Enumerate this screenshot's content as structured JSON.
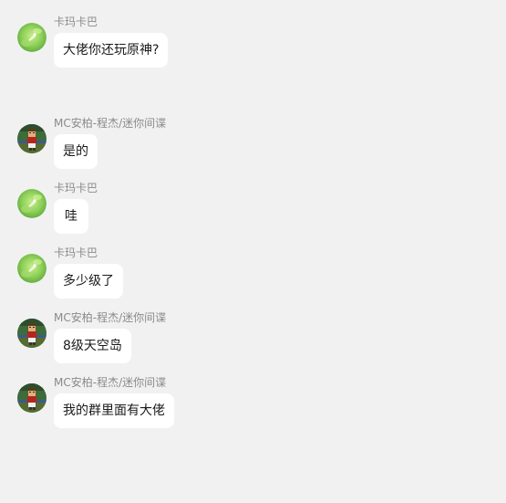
{
  "messages": [
    {
      "sender": "卡玛卡巴",
      "text": "大佬你还玩原神?",
      "avatar": "green-leaf-avatar"
    },
    {
      "sender": "MC安柏-程杰/迷你间谍",
      "text": "是的",
      "avatar": "pixel-character-avatar"
    },
    {
      "sender": "卡玛卡巴",
      "text": "哇",
      "avatar": "green-leaf-avatar"
    },
    {
      "sender": "卡玛卡巴",
      "text": "多少级了",
      "avatar": "green-leaf-avatar"
    },
    {
      "sender": "MC安柏-程杰/迷你间谍",
      "text": "8级天空岛",
      "avatar": "pixel-character-avatar"
    },
    {
      "sender": "MC安柏-程杰/迷你间谍",
      "text": "我的群里面有大佬",
      "avatar": "pixel-character-avatar"
    }
  ],
  "colors": {
    "background": "#f1f1f2",
    "bubble": "#ffffff",
    "sender_text": "#8a8a8a",
    "message_text": "#1a1a1a"
  }
}
